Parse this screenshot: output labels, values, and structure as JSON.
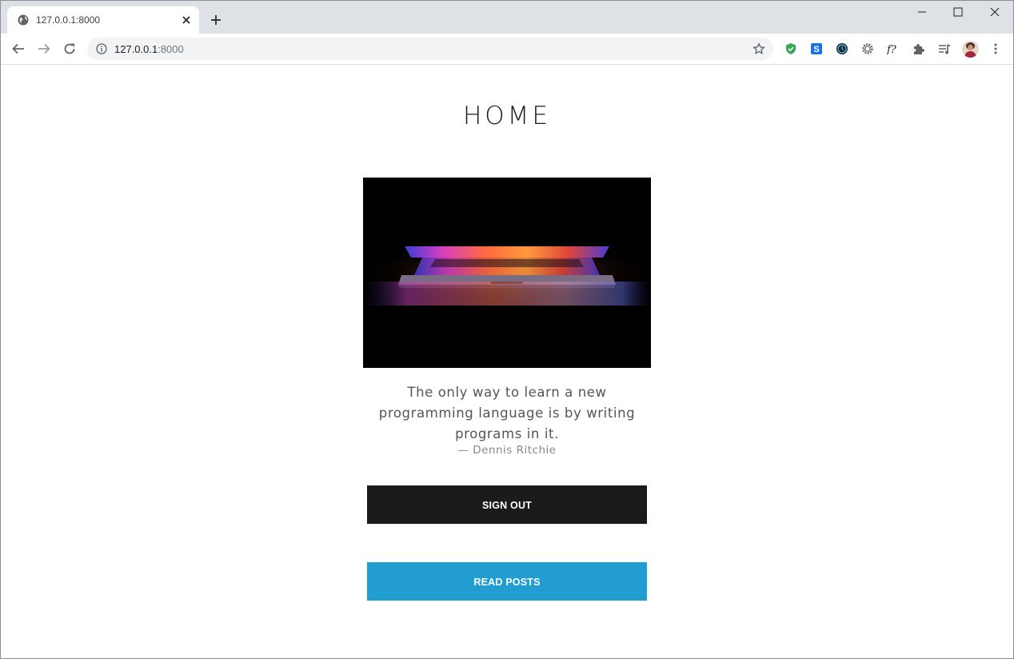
{
  "browser": {
    "tab_title": "127.0.0.1:8000",
    "url_host": "127.0.0.1",
    "url_port": ":8000"
  },
  "page": {
    "heading": "HOME",
    "quote": "The only way to learn a new programming language is by writing programs in it.",
    "author": "— Dennis Ritchie",
    "sign_out_label": "SIGN OUT",
    "read_posts_label": "READ POSTS"
  },
  "colors": {
    "sign_out_bg": "#1b1b1b",
    "read_posts_bg": "#219dd2",
    "heading": "#1c1c1c"
  },
  "icons": {
    "tab": [
      "globe-icon",
      "close-tab-icon",
      "new-tab-icon"
    ],
    "window": [
      "minimize-icon",
      "maximize-icon",
      "close-window-icon"
    ],
    "nav": [
      "back-arrow-icon",
      "forward-arrow-icon",
      "reload-icon",
      "site-info-icon",
      "bookmark-star-icon"
    ],
    "extensions": [
      "shield-extension-icon",
      "s-extension-icon",
      "clock-extension-icon",
      "gear-extension-icon",
      "font-question-extension-icon",
      "puzzle-extensions-icon",
      "media-queue-icon",
      "profile-avatar",
      "kebab-menu-icon"
    ]
  }
}
